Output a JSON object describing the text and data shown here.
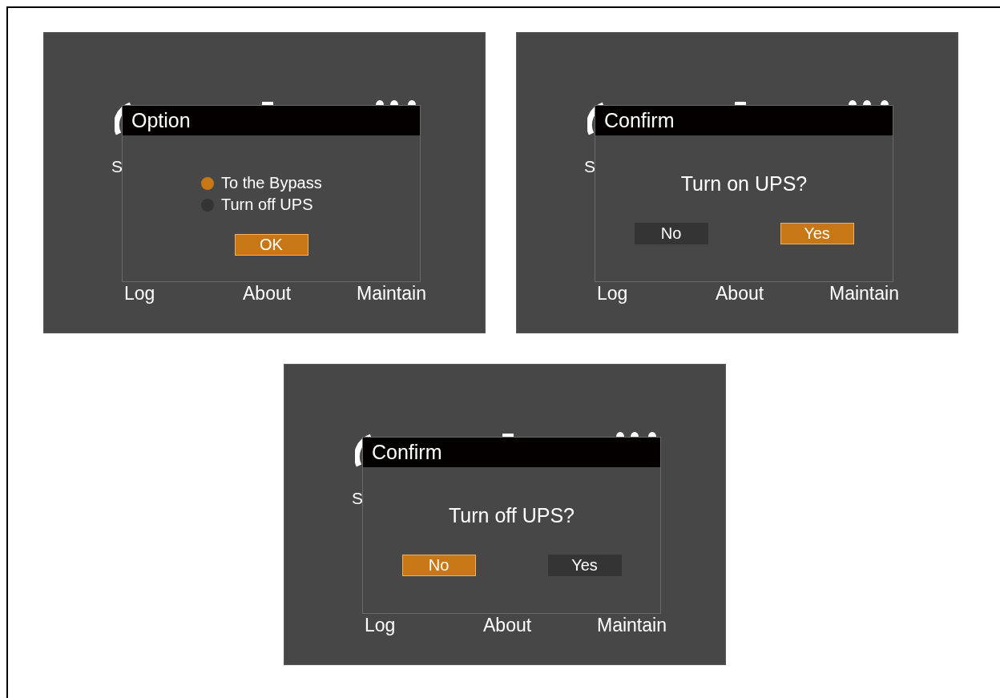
{
  "screens": [
    {
      "status_label": "S",
      "menu": [
        "Log",
        "About",
        "Maintain"
      ],
      "dialog": {
        "kind": "option",
        "title": "Option",
        "options": [
          {
            "label": "To the Bypass",
            "selected": true
          },
          {
            "label": "Turn off UPS",
            "selected": false
          }
        ],
        "buttons": [
          {
            "label": "OK",
            "selected": true
          }
        ]
      }
    },
    {
      "status_label": "S",
      "menu": [
        "Log",
        "About",
        "Maintain"
      ],
      "dialog": {
        "kind": "confirm",
        "title": "Confirm",
        "message": "Turn on UPS?",
        "buttons": [
          {
            "label": "No",
            "selected": false
          },
          {
            "label": "Yes",
            "selected": true
          }
        ]
      }
    },
    {
      "status_label": "S",
      "menu": [
        "Log",
        "About",
        "Maintain"
      ],
      "dialog": {
        "kind": "confirm",
        "title": "Confirm",
        "message": "Turn off UPS?",
        "buttons": [
          {
            "label": "No",
            "selected": true
          },
          {
            "label": "Yes",
            "selected": false
          }
        ]
      }
    }
  ]
}
